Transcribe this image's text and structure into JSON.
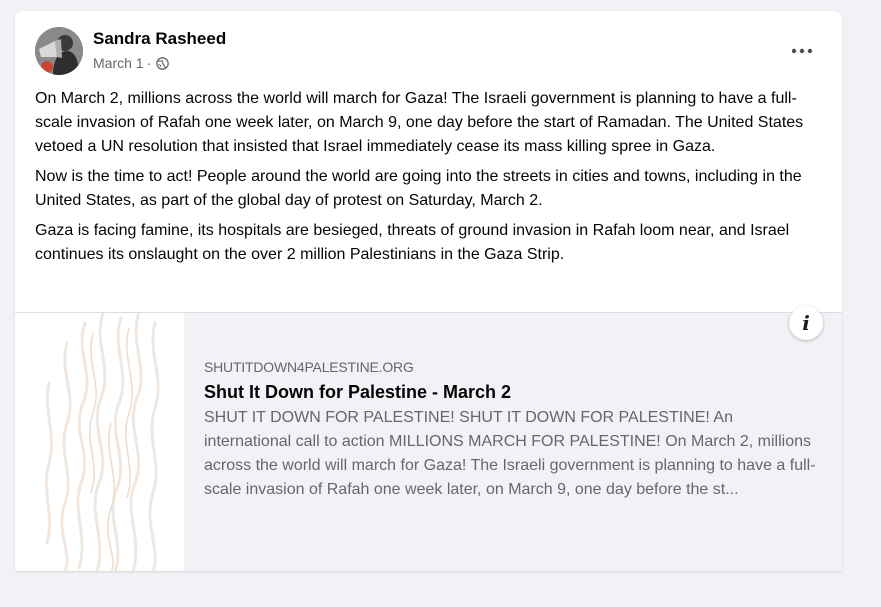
{
  "post": {
    "author": "Sandra Rasheed",
    "date": "March 1",
    "separator": " · ",
    "privacy_icon": "globe-icon",
    "more_icon": "more-options-icon",
    "paragraphs": [
      "On March 2, millions across the world will march for Gaza! The Israeli government is planning to have a full-scale invasion of Rafah one week later, on March 9, one day before the start of Ramadan. The United States vetoed a UN resolution that insisted that Israel immediately cease its mass killing spree in Gaza.",
      "Now is the time to act! People around the world are going into the streets in cities and towns, including in the United States, as part of the global day of protest on Saturday, March 2.",
      "Gaza is facing famine, its hospitals are besieged, threats of ground invasion in Rafah loom near, and Israel continues its onslaught on the over 2 million Palestinians in the Gaza Strip."
    ]
  },
  "link_preview": {
    "domain": "SHUTITDOWN4PALESTINE.ORG",
    "title": "Shut It Down for Palestine - March 2",
    "description": "SHUT IT DOWN FOR PALESTINE! SHUT IT DOWN FOR PALESTINE! An international call to action MILLIONS MARCH FOR PALESTINE! On March 2, millions across the world will march for Gaza! The Israeli government is planning to have a full-scale invasion of Rafah one week later, on March 9, one day before the st...",
    "info_icon_label": "i"
  },
  "colors": {
    "background": "#f0f2f5",
    "text_primary": "#050505",
    "text_secondary": "#65676b"
  }
}
